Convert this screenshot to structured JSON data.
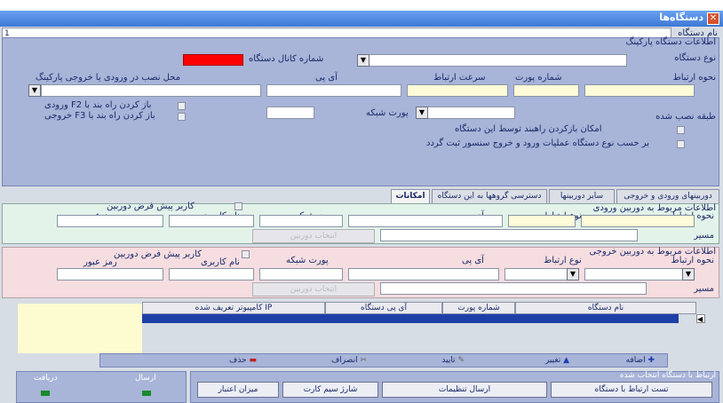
{
  "window": {
    "title": "دستگاه‌ها",
    "close_symbol": "✕"
  },
  "device_name": {
    "label": "نام دستگاه",
    "value": "1"
  },
  "parking_info": {
    "group_label": "اطلاعات دستگاه پارکینگ",
    "device_type_label": "نوع دستگاه",
    "channel_label": "شماره کانال دستگاه",
    "connection_mode_label": "نحوه ارتباط",
    "port_number_label": "شماره پورت",
    "speed_label": "سرعت ارتباط",
    "ip_label": "آی پی",
    "install_location_label": "محل نصب در ورودی یا خروجی پارکینگ",
    "install_floor_label": "طبقه نصب شده",
    "network_port_label": "پورت شبکه",
    "chk_f2_label": "باز کردن راه بند با F2 ورودی",
    "chk_f3_label": "باز کردن راه بند با F3 خروجی",
    "chk_open_label": "امکان بازکردن راهبند توسط این دستگاه",
    "chk_log_label": "بر حسب نوع دستگاه عملیات ورود و خروج سنسور ثبت گردد",
    "accent_red": "#ff0000"
  },
  "tabs": [
    "امکانات",
    "دسترسی گروهها به این دستگاه",
    "سایر دوربینها",
    "دوربینهای ورودی و خروجی اصلی"
  ],
  "entry_camera": {
    "group_label": "اطلاعات مربوط به دوربین ورودی",
    "connection_mode_label": "نحوه ارتباط",
    "connection_type_label": "نوع ارتباط",
    "ip_label": "آی پی",
    "network_port_label": "پورت شبکه",
    "default_user_label": "کاربر پیش فرض دوربین",
    "username_label": "نام کاربری",
    "password_label": "رمز عبور",
    "path_label": "مسیر",
    "select_camera_button": "انتخاب دوربین"
  },
  "exit_camera": {
    "group_label": "اطلاعات مربوط به دوربین خروجی",
    "connection_mode_label": "نحوه ارتباط",
    "connection_type_label": "نوع ارتباط",
    "ip_label": "آی پی",
    "network_port_label": "پورت شبکه",
    "default_user_label": "کاربر پیش فرض دوربین",
    "username_label": "نام کاربری",
    "password_label": "رمز عبور",
    "path_label": "مسیر",
    "select_camera_button": "انتخاب دوربین"
  },
  "grid": {
    "columns": [
      "نام دستگاه",
      "شماره پورت",
      "آی پی دستگاه",
      "IP کامپیوتر تعریف شده"
    ]
  },
  "toolbar": {
    "add": "اضافه",
    "edit": "تغییر",
    "confirm": "تایید",
    "cancel": "انصراف",
    "delete": "حذف"
  },
  "connection_panel": {
    "group_label": "ارتباط با دستگاه انتخاب شده",
    "test_button": "تست ارتباط با دستگاه",
    "send_settings_button": "ارسال تنظیمات",
    "charge_card_button": "شارژ سیم کارت",
    "credit_button": "میزان اعتبار",
    "send_label": "ارسال",
    "receive_label": "دریافت"
  }
}
